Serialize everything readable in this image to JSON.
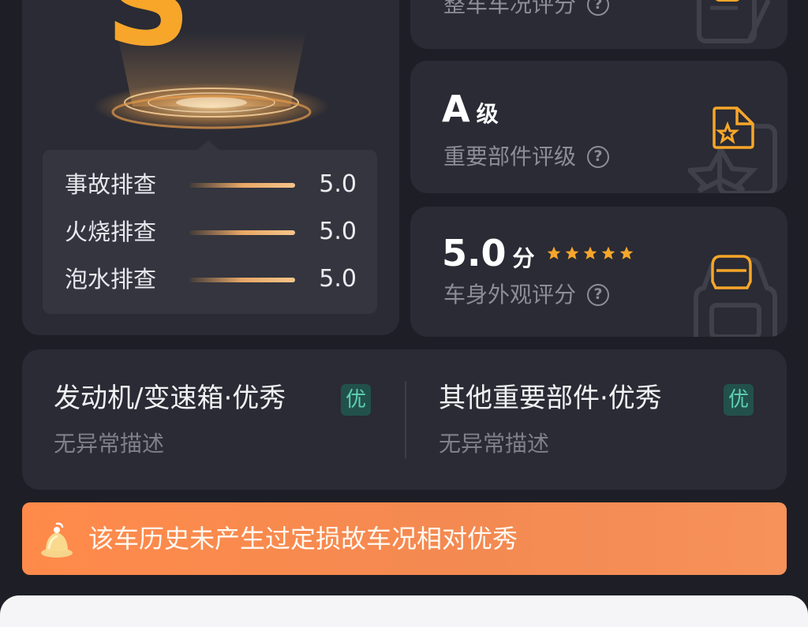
{
  "grade": {
    "letter": "S",
    "checks": [
      {
        "label": "事故排查",
        "score": "5.0"
      },
      {
        "label": "火烧排查",
        "score": "5.0"
      },
      {
        "label": "泡水排查",
        "score": "5.0"
      }
    ]
  },
  "overall": {
    "label": "整车车况评分"
  },
  "parts": {
    "value": "A",
    "unit": "级",
    "label": "重要部件评级"
  },
  "exterior": {
    "value": "5.0",
    "unit": "分",
    "stars": 5,
    "label": "车身外观评分"
  },
  "components": [
    {
      "title": "发动机/变速箱·优秀",
      "badge": "优",
      "desc": "无异常描述"
    },
    {
      "title": "其他重要部件·优秀",
      "badge": "优",
      "desc": "无异常描述"
    }
  ],
  "banner": {
    "text": "该车历史未产生过定损故车况相对优秀"
  },
  "help_symbol": "?",
  "colors": {
    "accent": "#f7a62a",
    "banner": "#ff8a4a",
    "badge_bg": "#22514b",
    "badge_text": "#5fd1b2"
  }
}
